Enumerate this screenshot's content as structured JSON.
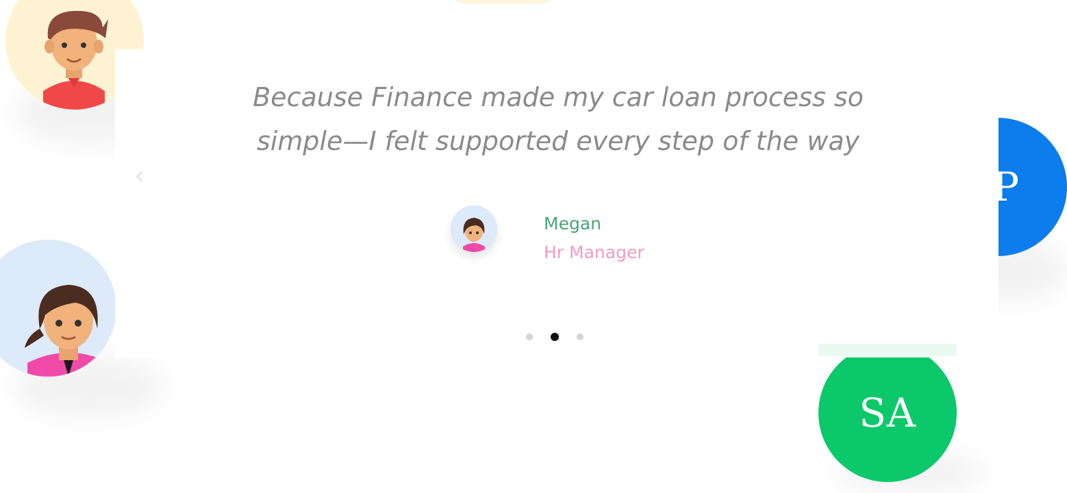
{
  "testimonial": {
    "quote_line1": "Because Finance made my car loan process so",
    "quote_line2": "simple—I felt supported every step of the way",
    "author_name": "Megan",
    "author_role": "Hr Manager"
  },
  "avatars": {
    "right_top_initials": "JP",
    "right_bottom_initials": "SA"
  },
  "navigation": {
    "prev_icon": "chevron-left-icon",
    "dots_count": 3,
    "active_dot": 2
  },
  "colors": {
    "jp_accent": "#0d7cec",
    "sa_accent": "#0bc96a",
    "name_color": "#4aa37a",
    "role_color": "#f19ac2"
  }
}
